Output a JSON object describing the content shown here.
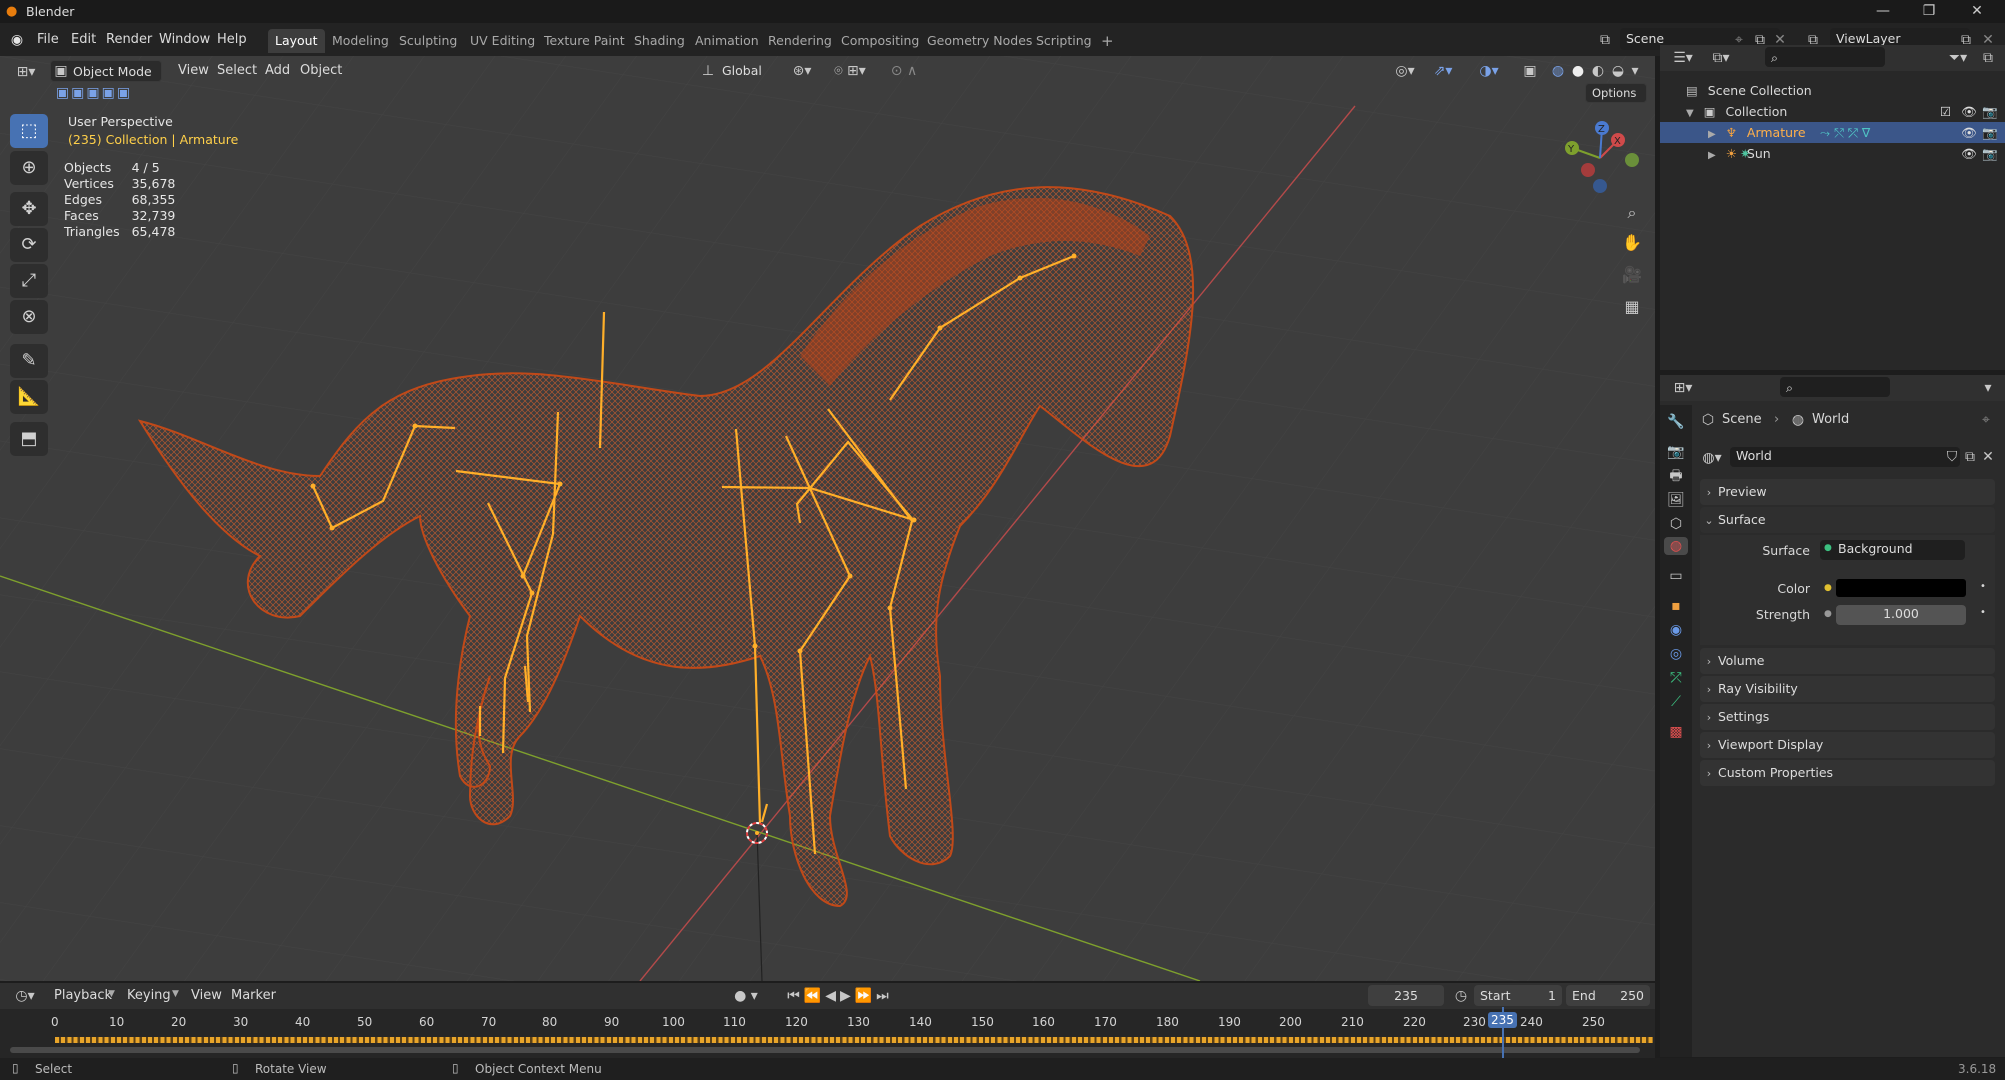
{
  "window": {
    "title": "Blender",
    "controls": [
      "—",
      "❐",
      "✕"
    ]
  },
  "menus": [
    "File",
    "Edit",
    "Render",
    "Window",
    "Help"
  ],
  "workspaces": [
    "Layout",
    "Modeling",
    "Sculpting",
    "UV Editing",
    "Texture Paint",
    "Shading",
    "Animation",
    "Rendering",
    "Compositing",
    "Geometry Nodes",
    "Scripting",
    "+"
  ],
  "active_workspace": "Layout",
  "scene": {
    "name": "Scene",
    "view_layer": "ViewLayer"
  },
  "viewport_header": {
    "mode": "Object Mode",
    "menus": [
      "View",
      "Select",
      "Add",
      "Object"
    ],
    "orientation": "Global",
    "options": "Options"
  },
  "overlay": {
    "perspective": "User Perspective",
    "context": "(235) Collection | Armature",
    "stats": [
      {
        "label": "Objects",
        "value": "4 / 5"
      },
      {
        "label": "Vertices",
        "value": "35,678"
      },
      {
        "label": "Edges",
        "value": "68,355"
      },
      {
        "label": "Faces",
        "value": "32,739"
      },
      {
        "label": "Triangles",
        "value": "65,478"
      }
    ]
  },
  "outliner": {
    "root": "Scene Collection",
    "collection": "Collection",
    "items": [
      {
        "name": "Armature",
        "selected": true
      },
      {
        "name": "Sun",
        "selected": false
      }
    ]
  },
  "properties": {
    "breadcrumb": [
      "Scene",
      "World"
    ],
    "world_name": "World",
    "panels": [
      "Preview",
      "Surface",
      "Volume",
      "Ray Visibility",
      "Settings",
      "Viewport Display",
      "Custom Properties"
    ],
    "surface": {
      "label": "Surface",
      "value": "Background"
    },
    "color": {
      "label": "Color",
      "value_hex": "#000000"
    },
    "strength": {
      "label": "Strength",
      "value": "1.000"
    }
  },
  "timeline": {
    "menus": [
      "Playback",
      "Keying",
      "View",
      "Marker"
    ],
    "current_frame": "235",
    "start_label": "Start",
    "start": "1",
    "end_label": "End",
    "end": "250",
    "ticks": [
      "0",
      "10",
      "20",
      "30",
      "40",
      "50",
      "60",
      "70",
      "80",
      "90",
      "100",
      "110",
      "120",
      "130",
      "140",
      "150",
      "160",
      "170",
      "180",
      "190",
      "200",
      "210",
      "220",
      "230",
      "235",
      "240",
      "250"
    ]
  },
  "statusbar": {
    "items": [
      "Select",
      "Rotate View",
      "Object Context Menu"
    ],
    "version": "3.6.18"
  },
  "colors": {
    "accent": "#4772b3",
    "selection": "#ffaf29",
    "mesh_wire": "#d4531a",
    "keyframe": "#e8a52a"
  }
}
